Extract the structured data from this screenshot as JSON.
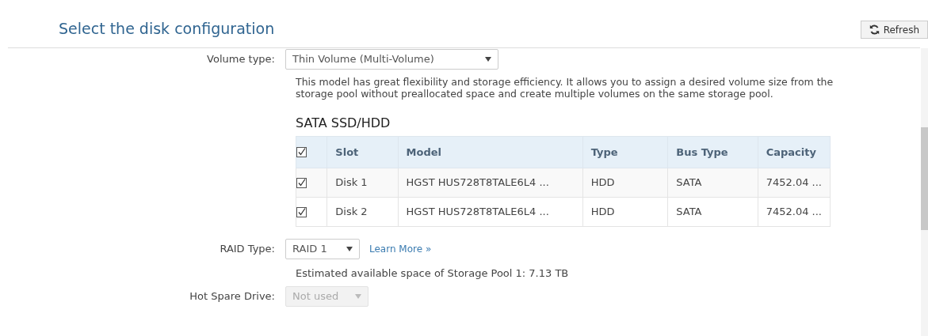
{
  "title": "Select the disk configuration",
  "refresh_button": {
    "label": "Refresh"
  },
  "volume_type": {
    "label": "Volume type:",
    "value": "Thin Volume (Multi-Volume)",
    "disabled": false
  },
  "description": "This model has great flexibility and storage efficiency. It allows you to assign a desired volume size from the storage pool without preallocated space and create multiple volumes on the same storage pool.",
  "disk_table": {
    "title": "SATA SSD/HDD",
    "all_checked": true,
    "columns": [
      "Slot",
      "Model",
      "Type",
      "Bus Type",
      "Capacity"
    ],
    "rows": [
      {
        "checked": true,
        "cells": [
          "Disk 1",
          "HGST HUS728T8TALE6L4 ...",
          "HDD",
          "SATA",
          "7452.04 ..."
        ]
      },
      {
        "checked": true,
        "cells": [
          "Disk 2",
          "HGST HUS728T8TALE6L4 ...",
          "HDD",
          "SATA",
          "7452.04 ..."
        ]
      }
    ]
  },
  "raid_type": {
    "label": "RAID Type:",
    "value": "RAID 1",
    "disabled": false,
    "link": "Learn More »"
  },
  "estimate": "Estimated available space of Storage Pool 1: 7.13 TB",
  "hot_spare": {
    "label": "Hot Spare Drive:",
    "value": "Not used",
    "disabled": true
  }
}
